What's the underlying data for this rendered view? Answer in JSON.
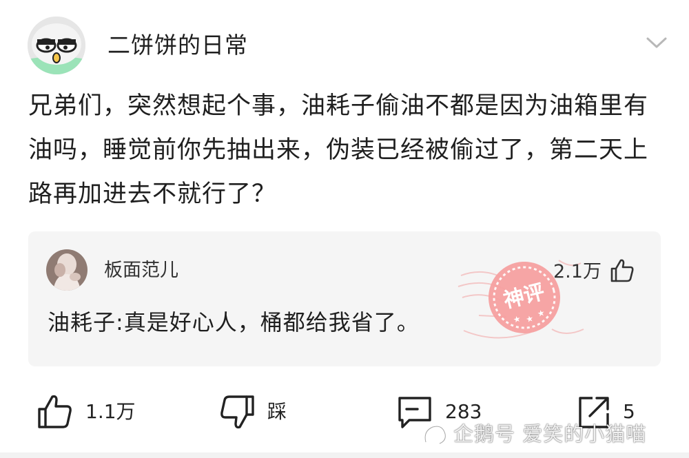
{
  "post": {
    "author_name": "二饼饼的日常",
    "content": "兄弟们，突然想起个事，油耗子偷油不都是因为油箱里有油吗，睡觉前你先抽出来，伪装已经被偷过了，第二天上路再加进去不就行了？"
  },
  "god_comment": {
    "author_name": "板面范儿",
    "likes": "2.1万",
    "text": "油耗子:真是好心人，桶都给我省了。",
    "badge_text": "神评",
    "badge_color": "#f08a8a"
  },
  "actions": {
    "like_count": "1.1万",
    "dislike_label": "踩",
    "comment_count": "283",
    "share_count": "5"
  },
  "watermark": {
    "text": "企鹅号 爱笑的小猫喵"
  },
  "icons": {
    "menu": "chevron-down-icon",
    "like": "thumbs-up-icon",
    "dislike": "thumbs-down-icon",
    "comment": "comment-bubble-icon",
    "share": "share-arrow-icon"
  }
}
